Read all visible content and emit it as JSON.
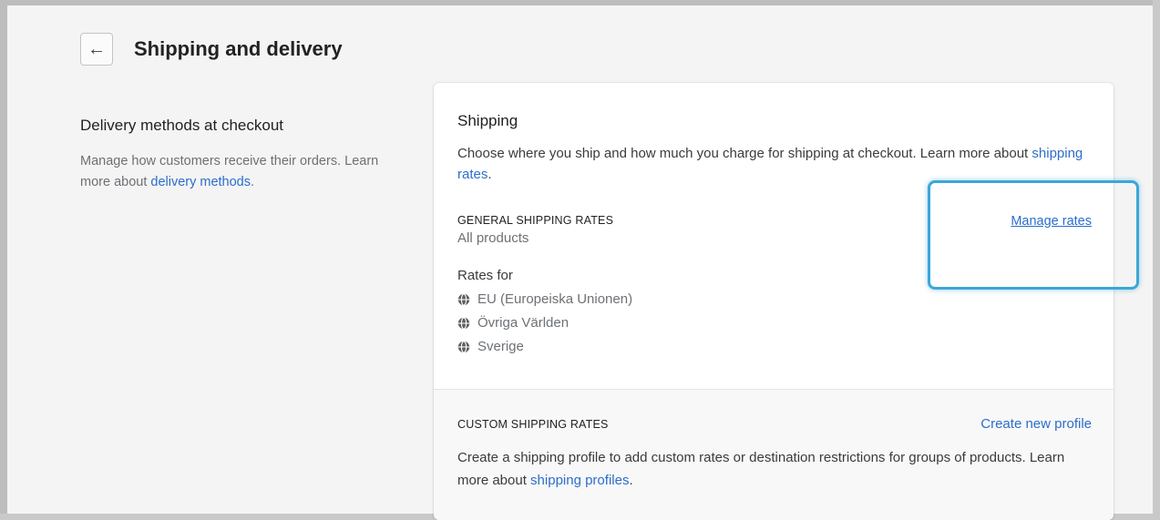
{
  "header": {
    "back_icon": "arrow-left-icon",
    "title": "Shipping and delivery"
  },
  "delivery_methods": {
    "title": "Delivery methods at checkout",
    "description_prefix": "Manage how customers receive their orders. Learn more about ",
    "link": "delivery methods",
    "suffix": "."
  },
  "shipping": {
    "title": "Shipping",
    "description_prefix": "Choose where you ship and how much you charge for shipping at checkout. Learn more about ",
    "link": "shipping rates",
    "suffix": ".",
    "general": {
      "label": "GENERAL SHIPPING RATES",
      "subtitle": "All products",
      "manage_link": "Manage rates",
      "rates_for_label": "Rates for",
      "regions": [
        "EU (Europeiska Unionen)",
        "Övriga Världen",
        "Sverige"
      ],
      "region_icon": "globe-icon"
    },
    "custom": {
      "label": "CUSTOM SHIPPING RATES",
      "create_link": "Create new profile",
      "description_prefix": "Create a shipping profile to add custom rates or destination restrictions for groups of products. Learn more about ",
      "link": "shipping profiles",
      "suffix": "."
    }
  },
  "colors": {
    "link": "#2c6ecb",
    "highlight": "#3ba7d8",
    "text": "#202223",
    "subdued": "#6d7175"
  }
}
